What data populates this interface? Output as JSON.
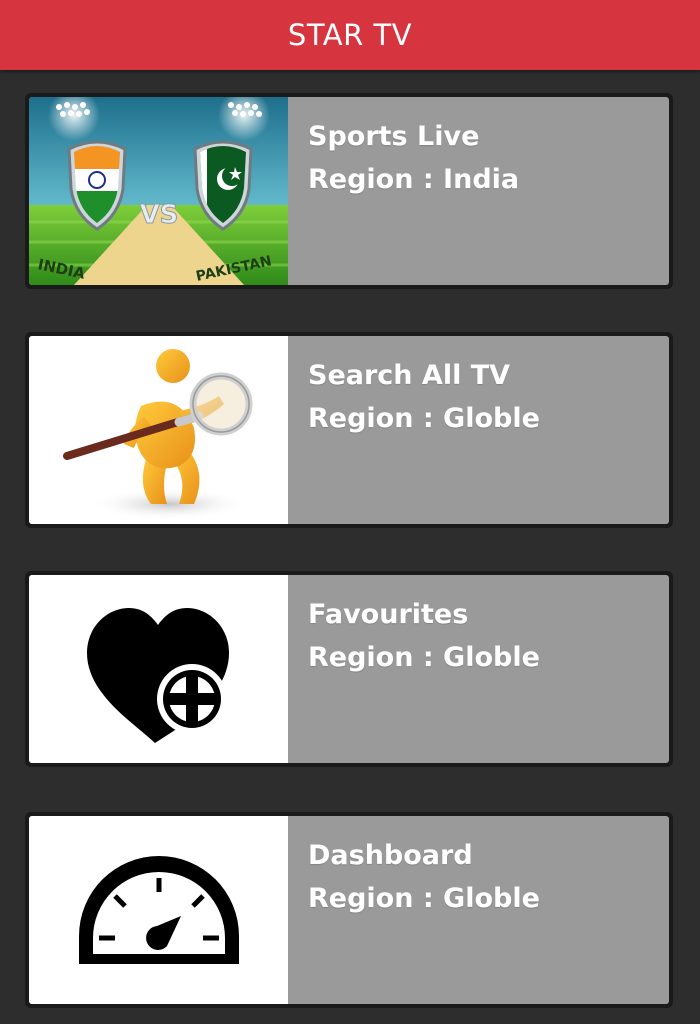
{
  "app": {
    "title": "STAR TV",
    "accent_color": "#d6343f"
  },
  "menu": [
    {
      "title": "Sports Live",
      "region": "Region : India",
      "thumbnail": {
        "icon": "india-vs-pakistan-cricket-image",
        "left_team": "INDIA",
        "right_team": "PAKISTAN",
        "versus": "VS"
      }
    },
    {
      "title": "Search All TV",
      "region": "Region : Globle",
      "thumbnail": {
        "icon": "magnifying-glass-person-icon"
      }
    },
    {
      "title": "Favourites",
      "region": "Region : Globle",
      "thumbnail": {
        "icon": "heart-plus-icon"
      }
    },
    {
      "title": "Dashboard",
      "region": "Region : Globle",
      "thumbnail": {
        "icon": "speedometer-icon"
      }
    }
  ]
}
